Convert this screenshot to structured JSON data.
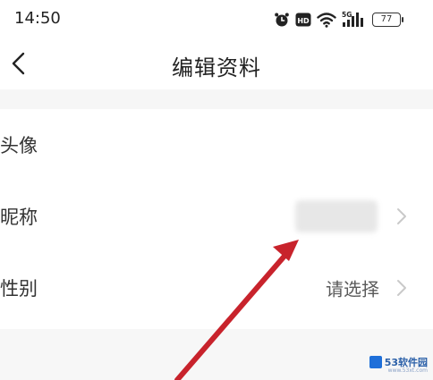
{
  "status_bar": {
    "time": "14:50",
    "network": "5G",
    "hd_badge": "HD",
    "battery": "77",
    "icons": [
      "alarm-icon",
      "hd-icon",
      "wifi-icon",
      "signal-icon",
      "battery-icon"
    ]
  },
  "nav": {
    "back_icon": "chevron-left-icon",
    "title": "编辑资料"
  },
  "form": {
    "rows": [
      {
        "label": "头像",
        "value": ""
      },
      {
        "label": "昵称",
        "value": ""
      },
      {
        "label": "性别",
        "value": "请选择"
      }
    ]
  },
  "annotation": {
    "arrow_color": "#c8232c"
  },
  "watermark": {
    "text": "53软件园",
    "sub": "www.53xt.com"
  },
  "colors": {
    "background": "#ffffff",
    "section_gap": "#f6f6f6",
    "label": "#333333",
    "placeholder": "#5a5a5a",
    "chevron": "#c9c9c9"
  }
}
